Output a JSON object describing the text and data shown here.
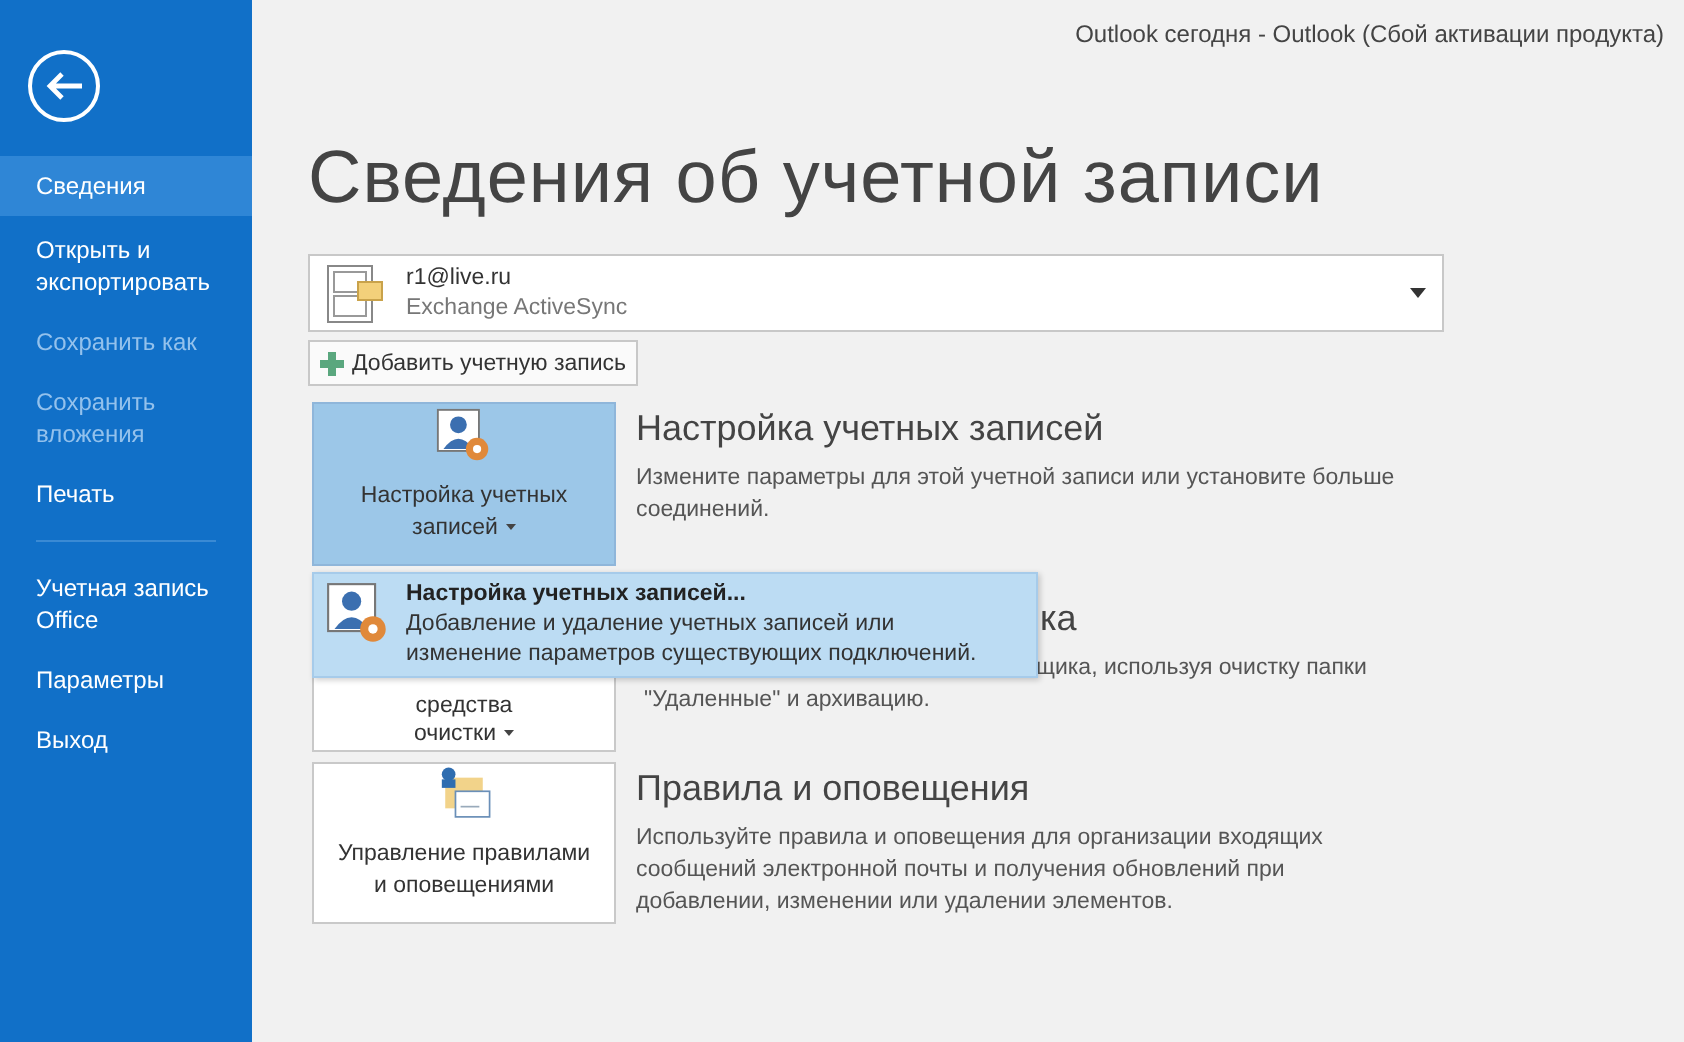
{
  "window": {
    "title": "Outlook сегодня - Outlook (Сбой активации продукта)"
  },
  "sidebar": {
    "items": [
      {
        "label": "Сведения",
        "selected": true,
        "disabled": false,
        "divider_after": false
      },
      {
        "label": "Открыть и экспортировать",
        "selected": false,
        "disabled": false,
        "divider_after": false
      },
      {
        "label": "Сохранить как",
        "selected": false,
        "disabled": true,
        "divider_after": false
      },
      {
        "label": "Сохранить вложения",
        "selected": false,
        "disabled": true,
        "divider_after": false
      },
      {
        "label": "Печать",
        "selected": false,
        "disabled": false,
        "divider_after": true
      },
      {
        "label": "Учетная запись Office",
        "selected": false,
        "disabled": false,
        "divider_after": false
      },
      {
        "label": "Параметры",
        "selected": false,
        "disabled": false,
        "divider_after": false
      },
      {
        "label": "Выход",
        "selected": false,
        "disabled": false,
        "divider_after": false
      }
    ]
  },
  "page_title": "Сведения об учетной записи",
  "account": {
    "email": "r1@live.ru",
    "type": "Exchange ActiveSync"
  },
  "add_account_button": "Добавить учетную запись",
  "sections": [
    {
      "kind": "settings",
      "button_lines": [
        "Настройка учетных",
        "записей"
      ],
      "dropdown": true,
      "selected": true,
      "heading": "Настройка учетных записей",
      "description_lines": [
        "Измените параметры для этой учетной записи или установите больше",
        "соединений."
      ]
    },
    {
      "kind": "cleanup",
      "button_lines": [
        "средства",
        "очистки"
      ],
      "dropdown": true,
      "selected": false,
      "heading": "ка",
      "description_lines": [
        "щика, используя очистку папки",
        "\"Удаленные\" и архивацию."
      ]
    },
    {
      "kind": "rules",
      "button_lines": [
        "Управление правилами",
        "и оповещениями"
      ],
      "dropdown": false,
      "selected": false,
      "heading": "Правила и оповещения",
      "description_lines": [
        "Используйте правила и оповещения для организации входящих",
        "сообщений электронной почты и получения обновлений при",
        "добавлении, изменении или удалении элементов."
      ]
    }
  ],
  "menu": {
    "title": "Настройка учетных записей...",
    "description_lines": [
      "Добавление и удаление учетных записей или",
      "изменение параметров существующих подключений."
    ]
  }
}
